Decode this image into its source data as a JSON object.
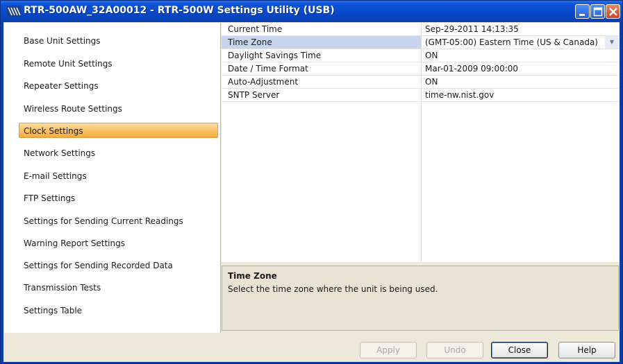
{
  "window": {
    "title": "RTR-500AW_32A00012 - RTR-500W Settings Utility (USB)",
    "icon": "app-logo-icon",
    "controls": [
      "minimize-icon",
      "maximize-icon",
      "close-icon"
    ]
  },
  "sidebar": {
    "items": [
      {
        "label": "Base Unit Settings"
      },
      {
        "label": "Remote Unit Settings"
      },
      {
        "label": "Repeater Settings"
      },
      {
        "label": "Wireless Route Settings"
      },
      {
        "label": "Clock Settings",
        "selected": true
      },
      {
        "label": "Network Settings"
      },
      {
        "label": "E-mail Settings"
      },
      {
        "label": "FTP Settings"
      },
      {
        "label": "Settings for Sending Current Readings"
      },
      {
        "label": "Warning Report Settings"
      },
      {
        "label": "Settings for Sending Recorded Data"
      },
      {
        "label": "Transmission Tests"
      },
      {
        "label": "Settings Table"
      }
    ]
  },
  "properties": [
    {
      "name": "Current Time",
      "value": "Sep-29-2011 14:13:35"
    },
    {
      "name": "Time Zone",
      "value": "(GMT-05:00) Eastern Time (US & Canada)",
      "selected": true,
      "dropdown": true
    },
    {
      "name": "Daylight Savings Time",
      "value": "ON"
    },
    {
      "name": "Date / Time Format",
      "value": "Mar-01-2009 09:00:00"
    },
    {
      "name": "Auto-Adjustment",
      "value": "ON"
    },
    {
      "name": "SNTP Server",
      "value": "time-nw.nist.gov"
    }
  ],
  "description": {
    "title": "Time Zone",
    "text": "Select the time zone where the unit is being used."
  },
  "buttons": {
    "apply": "Apply",
    "undo": "Undo",
    "close": "Close",
    "help": "Help"
  },
  "colors": {
    "titlebar": "#0648c8",
    "selected_nav": "#fbc46c",
    "selected_row": "#c6d4ee"
  }
}
